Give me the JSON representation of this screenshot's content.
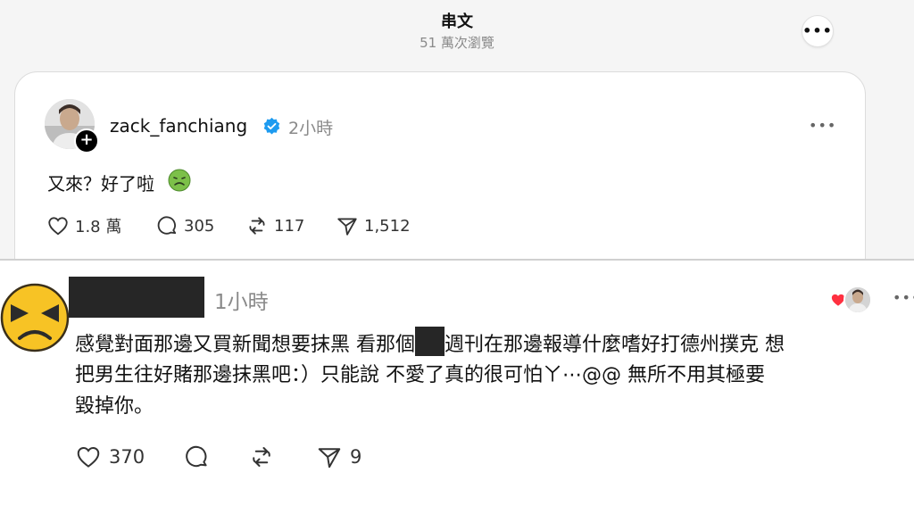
{
  "header": {
    "title": "串文",
    "views": "51 萬次瀏覽",
    "more_icon": "more-dots-icon"
  },
  "post": {
    "username": "zack_fanchiang",
    "time": "2小時",
    "text": "又來？好了啦",
    "emoji": "nauseated-face-icon",
    "likes": "1.8 萬",
    "comments": "305",
    "reposts": "117",
    "shares": "1,512"
  },
  "comment": {
    "time": "1小時",
    "line1a": "感覺對面那邊又買新聞想要抹黑 看那個",
    "line1b": "週刊在那邊報導什麼嗜好打德州撲克 想",
    "line2": "把男生往好賭那邊抹黑吧：）只能說 不愛了真的很可怕ㄚ⋯@@ 無所不用其極要",
    "line3": "毀掉你。",
    "likes": "370",
    "shares": "9"
  },
  "colors": {
    "verified": "#1d9bf0",
    "divider": "#d0d0d0",
    "redaction": "#262626",
    "angry_emoji": "#f7c325"
  }
}
